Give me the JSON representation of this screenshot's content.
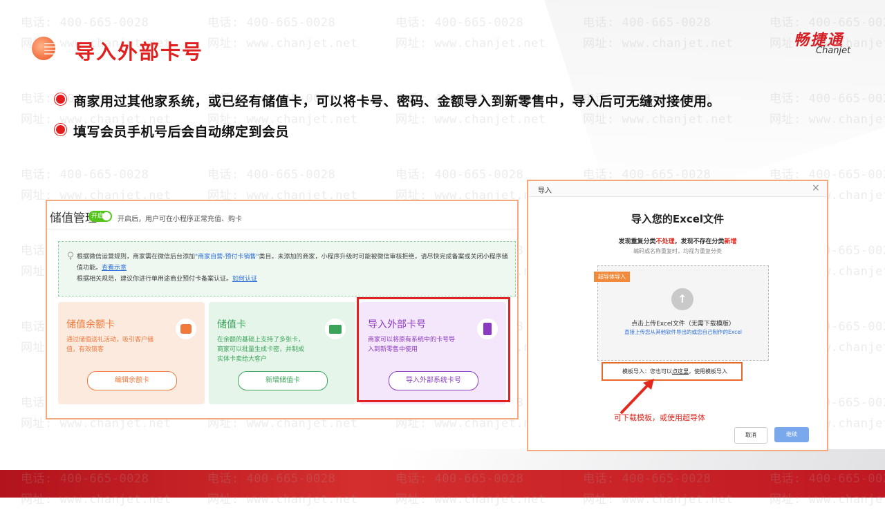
{
  "header": {
    "title": "导入外部卡号",
    "logo_cn": "畅捷通",
    "logo_en": "Chanjet"
  },
  "watermark": {
    "phone": "电话: 400-665-0028",
    "site": "网址: www.chanjet.net"
  },
  "bullets": [
    "商家用过其他家系统，或已经有储值卡，可以将卡号、密码、金额导入到新零售中，导入后可无缝对接使用。",
    "填写会员手机号后会自动绑定到会员"
  ],
  "left_screenshot": {
    "title": "储值管理",
    "toggle_label": "开启",
    "toggle_hint": "开启后，用户可在小程序正常充值、购卡",
    "notice_part1": "根据微信运营规则，商家需在微信后台添加",
    "notice_link1": "\"商家自营-预付卡销售\"",
    "notice_part2": "类目。未添加的商家，小程序升级时可能被微信审核拒绝，请尽快完成备案或关闭小程序储值功能。",
    "notice_link2": "查看示意",
    "notice_part3": "根据相关规范，建议你进行单用途商业预付卡备案认证。",
    "notice_link3": "如何认证",
    "cards": [
      {
        "title": "储值余额卡",
        "desc": "通过储值送礼活动，吸引客户储值，有效锁客",
        "button": "编辑余额卡",
        "color": "#f07a3c"
      },
      {
        "title": "储值卡",
        "desc": "在余额的基础上支持了多张卡，商家可以批量生成卡密，并制成实体卡卖给大客户",
        "button": "新增储值卡",
        "color": "#3aa55a"
      },
      {
        "title": "导入外部卡号",
        "desc": "商家可以将原有系统中的卡号导入到新零售中使用",
        "button": "导入外部系统卡号",
        "color": "#8a3bc2"
      }
    ]
  },
  "dialog": {
    "header": "导入",
    "close_icon": "×",
    "title": "导入您的Excel文件",
    "rule_prefix1": "发现重复分类",
    "rule_red1": "不处理",
    "rule_mid": "，发现不存在分类",
    "rule_red2": "新增",
    "rule2": "编码或名称重复时，均视为重复分类",
    "tag": "超导体导入",
    "upload_text": "点击上传Excel文件（无需下载模版）",
    "upload_sub": "直接上传您从其他软件导出的或您自己制作的Excel",
    "template_prefix": "模板导入：您也可以",
    "template_link": "点这里",
    "template_suffix": "，使用模板导入",
    "annotation": "可下载模板，或使用超导体",
    "cancel": "取消",
    "ok": "继续"
  }
}
